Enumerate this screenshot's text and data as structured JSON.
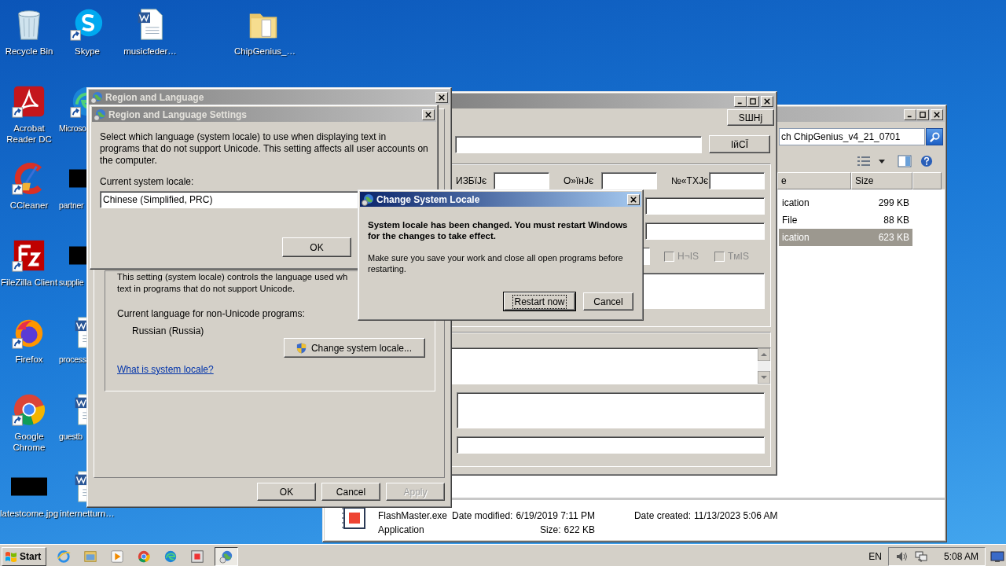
{
  "desktop": {
    "columns": [
      [
        {
          "label": "Recycle Bin",
          "kind": "recycle",
          "shortcut": false,
          "cut": false
        },
        {
          "label": "Acrobat Reader DC",
          "kind": "acrobat",
          "shortcut": true,
          "cut": false
        },
        {
          "label": "CCleaner",
          "kind": "ccleaner",
          "shortcut": true,
          "cut": false
        },
        {
          "label": "FileZilla Client",
          "kind": "filezilla",
          "shortcut": true,
          "cut": false
        },
        {
          "label": "Firefox",
          "kind": "firefox",
          "shortcut": true,
          "cut": false
        },
        {
          "label": "Google Chrome",
          "kind": "chrome",
          "shortcut": true,
          "cut": false
        },
        {
          "label": "latestcome.jpg",
          "kind": "blank",
          "shortcut": false,
          "cut": false
        }
      ],
      [
        {
          "label": "Skype",
          "kind": "skype",
          "shortcut": true,
          "cut": false
        },
        {
          "label": "Microso",
          "kind": "edge",
          "shortcut": true,
          "cut": true
        },
        {
          "label": "partner",
          "kind": "blank",
          "shortcut": false,
          "cut": true
        },
        {
          "label": "supplie",
          "kind": "blank",
          "shortcut": false,
          "cut": true
        },
        {
          "label": "process",
          "kind": "word",
          "shortcut": false,
          "cut": true
        },
        {
          "label": "guestb",
          "kind": "word",
          "shortcut": false,
          "cut": true
        },
        {
          "label": "internetturn…",
          "kind": "word",
          "shortcut": false,
          "cut": false
        }
      ],
      [
        {
          "label": "musicfeder…",
          "kind": "word",
          "shortcut": false,
          "cut": false
        }
      ],
      [
        {
          "label": "ChipGenius_…",
          "kind": "folder",
          "shortcut": false,
          "cut": false
        }
      ]
    ]
  },
  "explorer": {
    "active": false,
    "search": {
      "placeholder": "ch ChipGenius_v4_21_0701"
    },
    "columns": [
      "e",
      "Size"
    ],
    "rows": [
      {
        "column_1": "ication",
        "size": "299 KB",
        "selected": false
      },
      {
        "column_1": "File",
        "size": "88 KB",
        "selected": false
      },
      {
        "column_1": "ication",
        "size": "623 KB",
        "selected": true
      }
    ],
    "details": {
      "name": "FlashMaster.exe",
      "type": "Application",
      "modified_label": "Date modified:",
      "modified": "6/19/2019 7:11 PM",
      "size_label": "Size:",
      "size": "622 KB",
      "created_label": "Date created:",
      "created": "11/13/2023 5:06 AM"
    }
  },
  "chipgenius": {
    "active": false,
    "top_button": "SШНј",
    "query_button": "ІйСЇ",
    "labeled_fields": [
      {
        "label": "ИЗБїЈє"
      },
      {
        "label": "О»їнЈє"
      },
      {
        "label": "№«ТХЈє"
      }
    ],
    "checkboxes": [
      {
        "label": "H¬IS",
        "checked": false,
        "disabled": true
      },
      {
        "label": "TмIS",
        "checked": false,
        "disabled": true
      }
    ]
  },
  "region_window": {
    "title": "Region and Language",
    "active": false,
    "group_lines": [
      "This setting (system locale) controls the language used wh",
      "text in programs that do not support Unicode."
    ],
    "current_label": "Current language for non-Unicode programs:",
    "current_value": "Russian (Russia)",
    "change_button": "Change system locale...",
    "link": "What is system locale?",
    "buttons": [
      {
        "label": "OK",
        "disabled": false
      },
      {
        "label": "Cancel",
        "disabled": false
      },
      {
        "label": "Apply",
        "disabled": true
      }
    ]
  },
  "locale_settings": {
    "title": "Region and Language Settings",
    "active": false,
    "description": "Select which language (system locale) to use when displaying text in programs that do not support Unicode. This setting affects all user accounts on the computer.",
    "field_label": "Current system locale:",
    "field_value": "Chinese (Simplified, PRC)",
    "ok": "OK"
  },
  "change_dialog": {
    "title": "Change System Locale",
    "active": true,
    "headline": "System locale has been changed. You must restart Windows for the changes to take effect.",
    "message": "Make sure you save your work and close all open programs before restarting.",
    "buttons": [
      {
        "label": "Restart now",
        "default": true
      },
      {
        "label": "Cancel",
        "default": false
      }
    ]
  },
  "taskbar": {
    "start": "Start",
    "apps": [
      {
        "kind": "ie",
        "selected": false
      },
      {
        "kind": "folder",
        "selected": false
      },
      {
        "kind": "media",
        "selected": false
      },
      {
        "kind": "chrome",
        "selected": false
      },
      {
        "kind": "edge",
        "selected": false
      },
      {
        "kind": "chip",
        "selected": false
      },
      {
        "kind": "globe",
        "selected": true
      }
    ],
    "language": "EN",
    "clock": "5:08 AM"
  }
}
